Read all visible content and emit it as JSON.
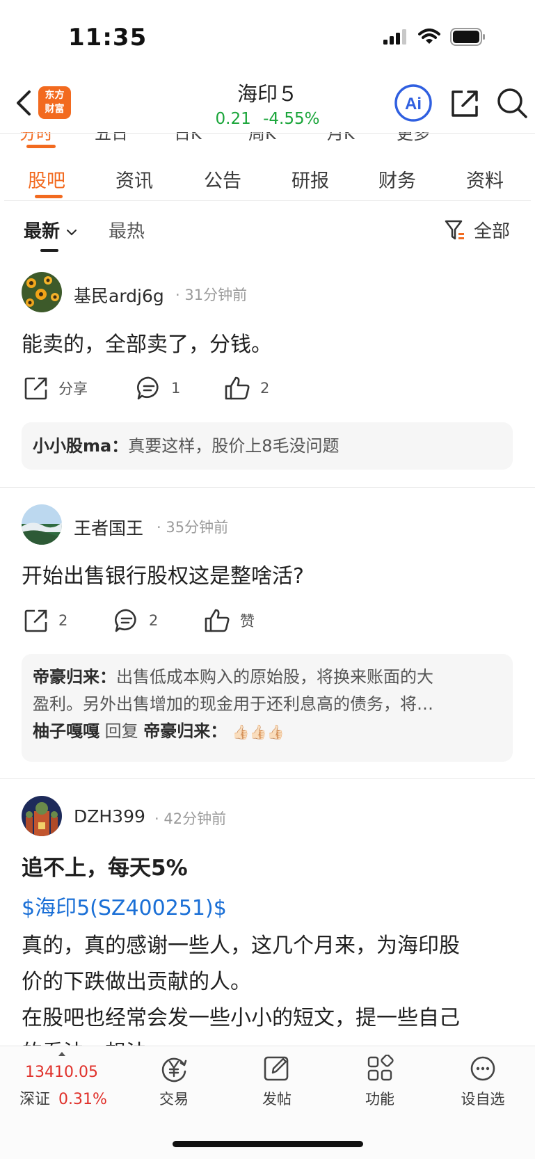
{
  "status_bar": {
    "time": "11:35"
  },
  "header": {
    "logo_line1": "东方",
    "logo_line2": "财富",
    "stock_name": "海印５",
    "price": "0.21",
    "change_pct": "-4.55%",
    "ai_label": "Ai"
  },
  "chart_tabs": [
    "分时",
    "五日",
    "日K",
    "周K",
    "月K",
    "更多"
  ],
  "main_tabs": [
    "股吧",
    "资讯",
    "公告",
    "研报",
    "财务",
    "资料"
  ],
  "sort": {
    "latest": "最新",
    "hot": "最热",
    "filter_label": "全部"
  },
  "posts": [
    {
      "username": "基民ardj6g",
      "time": "31分钟前",
      "body": "能卖的，全部卖了，分钱。",
      "share": "分享",
      "comments": "1",
      "likes": "2",
      "reply_author": "小小股ma：",
      "reply_text": "真要这样，股价上8毛没问题"
    },
    {
      "username": "王者国王",
      "time": "35分钟前",
      "body": "开始出售银行股权这是整啥活?",
      "share": "2",
      "comments": "2",
      "likes": "赞",
      "reply_author": "帝豪归来：",
      "reply_text_line1": "出售低成本购入的原始股，将换来账面的大",
      "reply_text_line2": "盈利。另外出售增加的现金用于还利息高的债务，将…",
      "nested_author": "柚子嘎嘎",
      "nested_verb": "回复",
      "nested_target": "帝豪归来：",
      "nested_emoji": "👍🏻👍🏻👍🏻"
    },
    {
      "username": "DZH399",
      "time": "42分钟前",
      "title": "追不上，每天5%",
      "stock_link": "$海印5(SZ400251)$",
      "body_line1": "真的，真的感谢一些人，这几个月来，为海印股",
      "body_line2": "价的下跌做出贡献的人。",
      "body_line3": "在股吧也经常会发一些小小的短文，提一些自己",
      "body_line4": "的看法，想法..."
    }
  ],
  "bottom_nav": {
    "index_value": "13410.05",
    "index_name": "深证",
    "index_change": "0.31%",
    "items": [
      "交易",
      "发帖",
      "功能",
      "设自选"
    ]
  },
  "colors": {
    "accent": "#f26a1f",
    "down": "#1aa53a",
    "up": "#e0302a",
    "link": "#1a6fd6",
    "ai_blue": "#2f5fe0"
  }
}
